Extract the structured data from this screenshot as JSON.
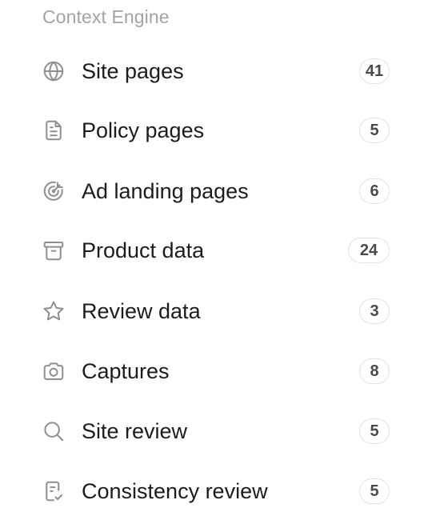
{
  "section": {
    "title": "Context Engine"
  },
  "items": [
    {
      "label": "Site pages",
      "count": "41",
      "icon": "globe-icon"
    },
    {
      "label": "Policy pages",
      "count": "5",
      "icon": "document-icon"
    },
    {
      "label": "Ad landing pages",
      "count": "6",
      "icon": "target-icon"
    },
    {
      "label": "Product data",
      "count": "24",
      "icon": "archive-box-icon"
    },
    {
      "label": "Review data",
      "count": "3",
      "icon": "star-icon"
    },
    {
      "label": "Captures",
      "count": "8",
      "icon": "camera-icon"
    },
    {
      "label": "Site review",
      "count": "5",
      "icon": "search-icon"
    },
    {
      "label": "Consistency review",
      "count": "5",
      "icon": "clipboard-check-icon"
    }
  ]
}
